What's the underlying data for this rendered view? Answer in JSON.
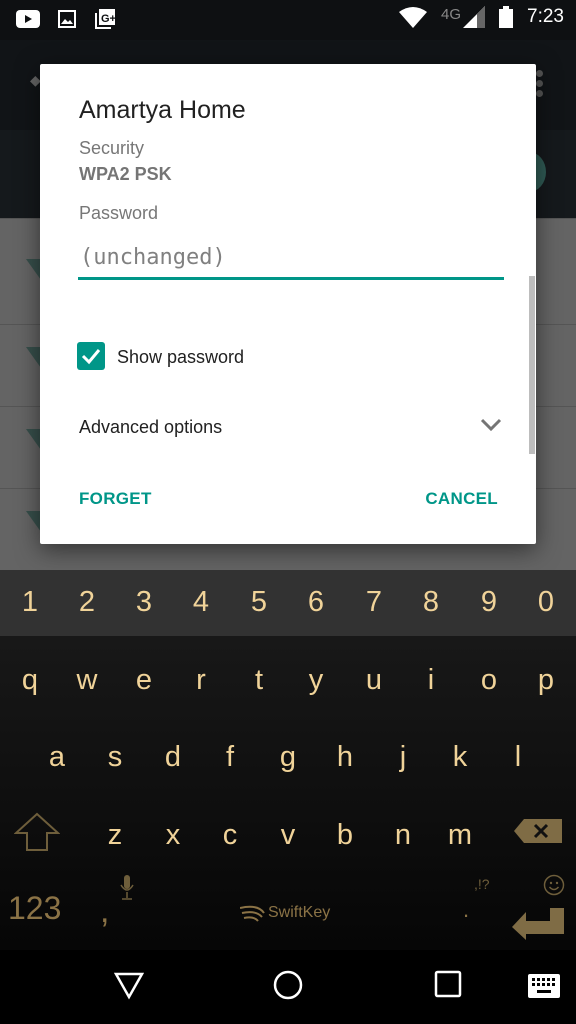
{
  "status_bar": {
    "left_icons": [
      "youtube-icon",
      "gallery-icon",
      "google-plus-icon"
    ],
    "network": "4G",
    "time": "7:23"
  },
  "dialog": {
    "title": "Amartya Home",
    "security_label": "Security",
    "security_value": "WPA2 PSK",
    "password_label": "Password",
    "password_placeholder": "(unchanged)",
    "password_value": "",
    "show_password_label": "Show password",
    "show_password_checked": true,
    "advanced_options_label": "Advanced options",
    "forget_label": "FORGET",
    "cancel_label": "CANCEL",
    "accent_color": "#009688"
  },
  "keyboard": {
    "brand": "SwiftKey",
    "number_row": [
      "1",
      "2",
      "3",
      "4",
      "5",
      "6",
      "7",
      "8",
      "9",
      "0"
    ],
    "row1": [
      "q",
      "w",
      "e",
      "r",
      "t",
      "y",
      "u",
      "i",
      "o",
      "p"
    ],
    "row2": [
      "a",
      "s",
      "d",
      "f",
      "g",
      "h",
      "j",
      "k",
      "l"
    ],
    "row3": [
      "z",
      "x",
      "c",
      "v",
      "b",
      "n",
      "m"
    ],
    "symbols_key": "123",
    "comma_key": ",",
    "period_key": ".",
    "punct_hint": ",!?",
    "key_color": "#f0d399"
  },
  "nav_bar": {
    "buttons": [
      "back-icon",
      "home-icon",
      "recents-icon",
      "keyboard-icon"
    ]
  }
}
